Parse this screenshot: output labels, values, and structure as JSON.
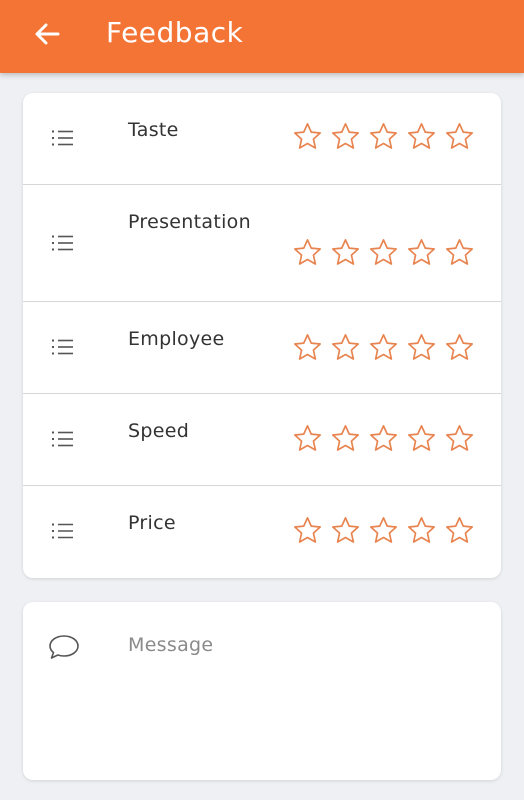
{
  "appbar": {
    "title": "Feedback",
    "back_icon": "arrow-left-icon",
    "color": "#f47436"
  },
  "ratings": [
    {
      "label": "Taste",
      "icon": "list-icon",
      "stars": 0,
      "max_stars": 5
    },
    {
      "label": "Presentation",
      "icon": "list-icon",
      "stars": 0,
      "max_stars": 5
    },
    {
      "label": "Employee",
      "icon": "list-icon",
      "stars": 0,
      "max_stars": 5
    },
    {
      "label": "Speed",
      "icon": "list-icon",
      "stars": 0,
      "max_stars": 5
    },
    {
      "label": "Price",
      "icon": "list-icon",
      "stars": 0,
      "max_stars": 5
    }
  ],
  "message": {
    "icon": "chat-bubble-icon",
    "placeholder": "Message",
    "value": ""
  },
  "colors": {
    "accent": "#f47436",
    "star_outline": "#e8844f",
    "background": "#eef0f4",
    "card": "#ffffff"
  }
}
